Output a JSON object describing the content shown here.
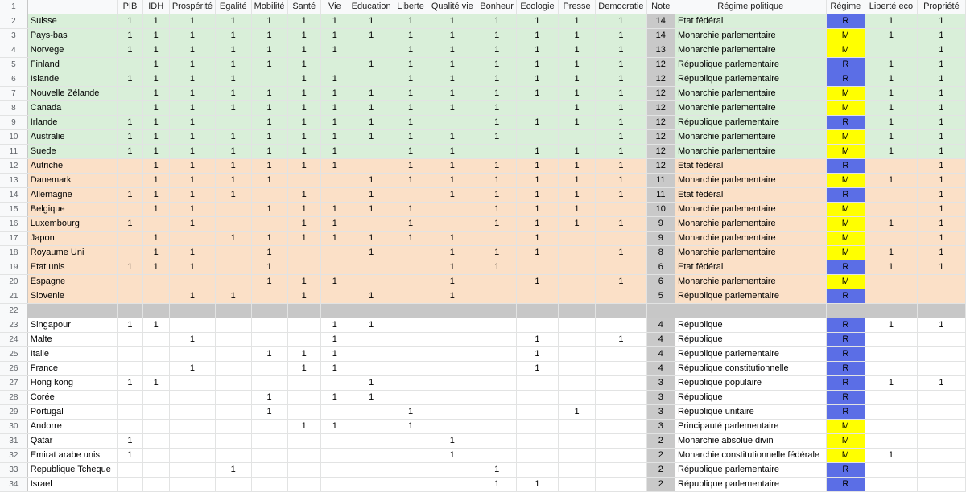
{
  "columns": [
    "",
    "PIB",
    "IDH",
    "Prospérité",
    "Egalité",
    "Mobilité",
    "Santé",
    "Vie",
    "Education",
    "Liberte",
    "Qualité vie",
    "Bonheur",
    "Ecologie",
    "Presse",
    "Democratie",
    "Note",
    "Régime politique",
    "Régime",
    "Liberté eco",
    "Propriété"
  ],
  "header_row_number": "1",
  "rows": [
    {
      "n": "2",
      "group": "green",
      "c": [
        "Suisse",
        "1",
        "1",
        "1",
        "1",
        "1",
        "1",
        "1",
        "1",
        "1",
        "1",
        "1",
        "1",
        "1",
        "1",
        "14",
        "Etat fédéral",
        "R",
        "1",
        "1"
      ]
    },
    {
      "n": "3",
      "group": "green",
      "c": [
        "Pays-bas",
        "1",
        "1",
        "1",
        "1",
        "1",
        "1",
        "1",
        "1",
        "1",
        "1",
        "1",
        "1",
        "1",
        "1",
        "14",
        "Monarchie parlementaire",
        "M",
        "1",
        "1"
      ]
    },
    {
      "n": "4",
      "group": "green",
      "c": [
        "Norvege",
        "1",
        "1",
        "1",
        "1",
        "1",
        "1",
        "1",
        "",
        "1",
        "1",
        "1",
        "1",
        "1",
        "1",
        "13",
        "Monarchie parlementaire",
        "M",
        "",
        "1"
      ]
    },
    {
      "n": "5",
      "group": "green",
      "c": [
        "Finland",
        "",
        "1",
        "1",
        "1",
        "1",
        "1",
        "",
        "1",
        "1",
        "1",
        "1",
        "1",
        "1",
        "1",
        "12",
        "République parlementaire",
        "R",
        "1",
        "1"
      ]
    },
    {
      "n": "6",
      "group": "green",
      "c": [
        "Islande",
        "1",
        "1",
        "1",
        "1",
        "",
        "1",
        "1",
        "",
        "1",
        "1",
        "1",
        "1",
        "1",
        "1",
        "12",
        "République parlementaire",
        "R",
        "1",
        "1"
      ]
    },
    {
      "n": "7",
      "group": "green",
      "c": [
        "Nouvelle Zélande",
        "",
        "1",
        "1",
        "1",
        "1",
        "1",
        "1",
        "1",
        "1",
        "1",
        "1",
        "1",
        "1",
        "1",
        "12",
        "Monarchie parlementaire",
        "M",
        "1",
        "1"
      ]
    },
    {
      "n": "8",
      "group": "green",
      "c": [
        "Canada",
        "",
        "1",
        "1",
        "1",
        "1",
        "1",
        "1",
        "1",
        "1",
        "1",
        "1",
        "",
        "1",
        "1",
        "12",
        "Monarchie parlementaire",
        "M",
        "1",
        "1"
      ]
    },
    {
      "n": "9",
      "group": "green",
      "c": [
        "Irlande",
        "1",
        "1",
        "1",
        "",
        "1",
        "1",
        "1",
        "1",
        "1",
        "",
        "1",
        "1",
        "1",
        "1",
        "12",
        "République parlementaire",
        "R",
        "1",
        "1"
      ]
    },
    {
      "n": "10",
      "group": "green",
      "c": [
        "Australie",
        "1",
        "1",
        "1",
        "1",
        "1",
        "1",
        "1",
        "1",
        "1",
        "1",
        "1",
        "",
        "",
        "1",
        "12",
        "Monarchie parlementaire",
        "M",
        "1",
        "1"
      ]
    },
    {
      "n": "11",
      "group": "green",
      "c": [
        "Suede",
        "1",
        "1",
        "1",
        "1",
        "1",
        "1",
        "1",
        "",
        "1",
        "1",
        "",
        "1",
        "1",
        "1",
        "12",
        "Monarchie parlementaire",
        "M",
        "1",
        "1"
      ]
    },
    {
      "n": "12",
      "group": "orange",
      "c": [
        "Autriche",
        "",
        "1",
        "1",
        "1",
        "1",
        "1",
        "1",
        "",
        "1",
        "1",
        "1",
        "1",
        "1",
        "1",
        "12",
        "Etat fédéral",
        "R",
        "",
        "1"
      ]
    },
    {
      "n": "13",
      "group": "orange",
      "c": [
        "Danemark",
        "",
        "1",
        "1",
        "1",
        "1",
        "",
        "",
        "1",
        "1",
        "1",
        "1",
        "1",
        "1",
        "1",
        "11",
        "Monarchie parlementaire",
        "M",
        "1",
        "1"
      ]
    },
    {
      "n": "14",
      "group": "orange",
      "c": [
        "Allemagne",
        "1",
        "1",
        "1",
        "1",
        "",
        "1",
        "",
        "1",
        "",
        "1",
        "1",
        "1",
        "1",
        "1",
        "11",
        "Etat fédéral",
        "R",
        "",
        "1"
      ]
    },
    {
      "n": "15",
      "group": "orange",
      "c": [
        "Belgique",
        "",
        "1",
        "1",
        "",
        "1",
        "1",
        "1",
        "1",
        "1",
        "",
        "1",
        "1",
        "1",
        "",
        "10",
        "Monarchie parlementaire",
        "M",
        "",
        "1"
      ]
    },
    {
      "n": "16",
      "group": "orange",
      "c": [
        "Luxembourg",
        "1",
        "",
        "1",
        "",
        "",
        "1",
        "1",
        "",
        "1",
        "",
        "1",
        "1",
        "1",
        "1",
        "9",
        "Monarchie parlementaire",
        "M",
        "1",
        "1"
      ]
    },
    {
      "n": "17",
      "group": "orange",
      "c": [
        "Japon",
        "",
        "1",
        "",
        "1",
        "1",
        "1",
        "1",
        "1",
        "1",
        "1",
        "",
        "1",
        "",
        "",
        "9",
        "Monarchie parlementaire",
        "M",
        "",
        "1"
      ]
    },
    {
      "n": "18",
      "group": "orange",
      "c": [
        "Royaume Uni",
        "",
        "1",
        "1",
        "",
        "1",
        "",
        "",
        "1",
        "",
        "1",
        "1",
        "1",
        "",
        "1",
        "8",
        "Monarchie parlementaire",
        "M",
        "1",
        "1"
      ]
    },
    {
      "n": "19",
      "group": "orange",
      "c": [
        "Etat unis",
        "1",
        "1",
        "1",
        "",
        "1",
        "",
        "",
        "",
        "",
        "1",
        "1",
        "",
        "",
        "",
        "6",
        "Etat fédéral",
        "R",
        "1",
        "1"
      ]
    },
    {
      "n": "20",
      "group": "orange",
      "c": [
        "Espagne",
        "",
        "",
        "",
        "",
        "1",
        "1",
        "1",
        "",
        "",
        "1",
        "",
        "1",
        "",
        "1",
        "6",
        "Monarchie parlementaire",
        "M",
        "",
        ""
      ]
    },
    {
      "n": "21",
      "group": "orange",
      "c": [
        "Slovenie",
        "",
        "",
        "1",
        "1",
        "",
        "1",
        "",
        "1",
        "",
        "1",
        "",
        "",
        "",
        "",
        "5",
        "République parlementaire",
        "R",
        "",
        ""
      ]
    },
    {
      "n": "22",
      "group": "sep",
      "c": [
        "",
        "",
        "",
        "",
        "",
        "",
        "",
        "",
        "",
        "",
        "",
        "",
        "",
        "",
        "",
        "",
        "",
        "",
        "",
        ""
      ]
    },
    {
      "n": "23",
      "group": "white",
      "c": [
        "Singapour",
        "1",
        "1",
        "",
        "",
        "",
        "",
        "1",
        "1",
        "",
        "",
        "",
        "",
        "",
        "",
        "4",
        "République",
        "R",
        "1",
        "1"
      ]
    },
    {
      "n": "24",
      "group": "white",
      "c": [
        "Malte",
        "",
        "",
        "1",
        "",
        "",
        "",
        "1",
        "",
        "",
        "",
        "",
        "1",
        "",
        "1",
        "4",
        "République",
        "R",
        "",
        ""
      ]
    },
    {
      "n": "25",
      "group": "white",
      "c": [
        "Italie",
        "",
        "",
        "",
        "",
        "1",
        "1",
        "1",
        "",
        "",
        "",
        "",
        "1",
        "",
        "",
        "4",
        "République parlementaire",
        "R",
        "",
        ""
      ]
    },
    {
      "n": "26",
      "group": "white",
      "c": [
        "France",
        "",
        "",
        "1",
        "",
        "",
        "1",
        "1",
        "",
        "",
        "",
        "",
        "1",
        "",
        "",
        "4",
        "République constitutionnelle",
        "R",
        "",
        ""
      ]
    },
    {
      "n": "27",
      "group": "white",
      "c": [
        "Hong kong",
        "1",
        "1",
        "",
        "",
        "",
        "",
        "",
        "1",
        "",
        "",
        "",
        "",
        "",
        "",
        "3",
        "République populaire",
        "R",
        "1",
        "1"
      ]
    },
    {
      "n": "28",
      "group": "white",
      "c": [
        "Corée",
        "",
        "",
        "",
        "",
        "1",
        "",
        "1",
        "1",
        "",
        "",
        "",
        "",
        "",
        "",
        "3",
        "République",
        "R",
        "",
        ""
      ]
    },
    {
      "n": "29",
      "group": "white",
      "c": [
        "Portugal",
        "",
        "",
        "",
        "",
        "1",
        "",
        "",
        "",
        "1",
        "",
        "",
        "",
        "1",
        "",
        "3",
        "République unitaire",
        "R",
        "",
        ""
      ]
    },
    {
      "n": "30",
      "group": "white",
      "c": [
        "Andorre",
        "",
        "",
        "",
        "",
        "",
        "1",
        "1",
        "",
        "1",
        "",
        "",
        "",
        "",
        "",
        "3",
        "Principauté parlementaire",
        "M",
        "",
        ""
      ]
    },
    {
      "n": "31",
      "group": "white",
      "c": [
        "Qatar",
        "1",
        "",
        "",
        "",
        "",
        "",
        "",
        "",
        "",
        "1",
        "",
        "",
        "",
        "",
        "2",
        "Monarchie absolue divin",
        "M",
        "",
        ""
      ]
    },
    {
      "n": "32",
      "group": "white",
      "c": [
        "Emirat arabe unis",
        "1",
        "",
        "",
        "",
        "",
        "",
        "",
        "",
        "",
        "1",
        "",
        "",
        "",
        "",
        "2",
        "Monarchie constitutionnelle fédérale",
        "M",
        "1",
        ""
      ]
    },
    {
      "n": "33",
      "group": "white",
      "c": [
        "Republique Tcheque",
        "",
        "",
        "",
        "1",
        "",
        "",
        "",
        "",
        "",
        "",
        "1",
        "",
        "",
        "",
        "2",
        "République parlementaire",
        "R",
        "",
        ""
      ]
    },
    {
      "n": "34",
      "group": "white",
      "c": [
        "Israel",
        "",
        "",
        "",
        "",
        "",
        "",
        "",
        "",
        "",
        "",
        "1",
        "1",
        "",
        "",
        "2",
        "République parlementaire",
        "R",
        "",
        ""
      ]
    }
  ]
}
